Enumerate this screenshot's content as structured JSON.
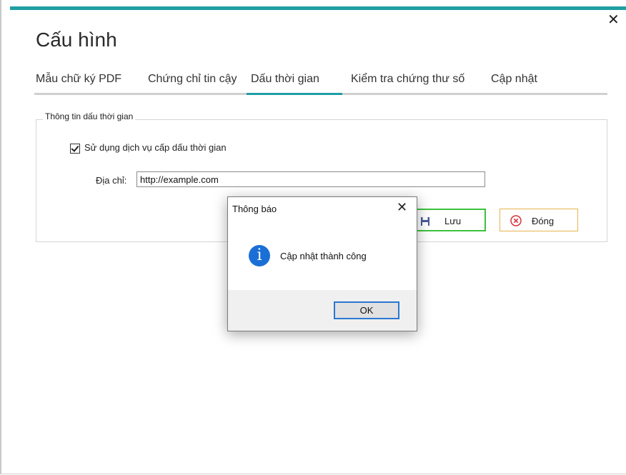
{
  "window": {
    "title": "Cấu hình",
    "close_glyph": "✕"
  },
  "tabs": [
    {
      "label": "Mẫu chữ ký PDF",
      "active": false
    },
    {
      "label": "Chứng chỉ tin cậy",
      "active": false
    },
    {
      "label": "Dấu thời gian",
      "active": true
    },
    {
      "label": "Kiểm tra chứng thư số",
      "active": false
    },
    {
      "label": "Cập nhật",
      "active": false
    }
  ],
  "group": {
    "legend": "Thông tin dấu thời gian",
    "checkbox_label": "Sử dụng dịch vụ cấp dấu thời gian",
    "checkbox_checked": true,
    "address_label": "Địa chỉ:",
    "address_value": "http://example.com"
  },
  "buttons": {
    "save_label": "Lưu",
    "close_label": "Đóng"
  },
  "dialog": {
    "title": "Thông báo",
    "close_glyph": "✕",
    "icon": "info-icon",
    "message": "Cập nhật thành công",
    "ok_label": "OK"
  },
  "colors": {
    "accent": "#1f9ea3",
    "save_border": "#3cc23c",
    "close_border": "#e8b34f",
    "info_blue": "#1a6fd6"
  }
}
